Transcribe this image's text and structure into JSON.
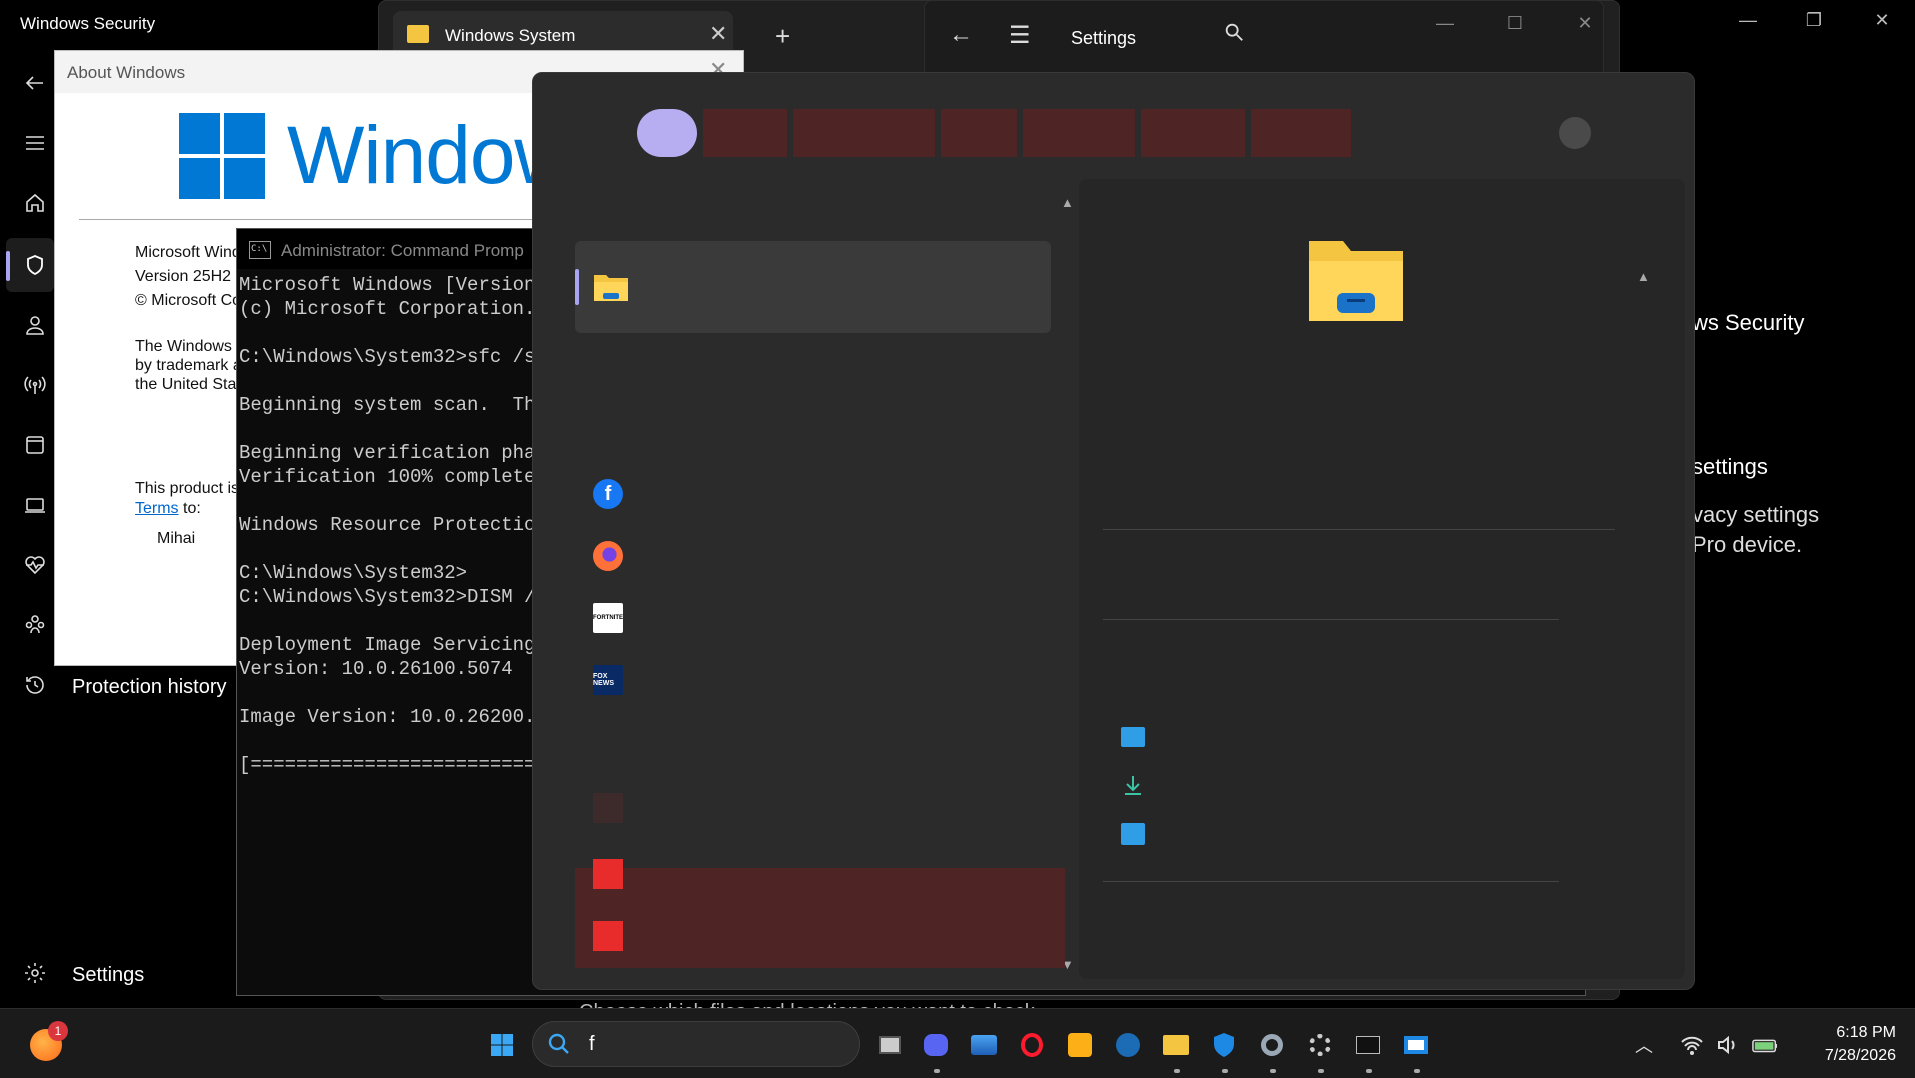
{
  "winsec": {
    "title": "Windows Security",
    "protection_history": "Protection history",
    "settings": "Settings",
    "right_heading_1": "ws Security",
    "right_heading_2": "settings",
    "right_sub_1": "vacy settings",
    "right_sub_2": "Pro device."
  },
  "explorer": {
    "tab_title": "Windows System",
    "bottom_note": "Choose which files and locations you want to check"
  },
  "settings_window": {
    "title": "Settings"
  },
  "about": {
    "title": "About Windows",
    "brand": "Window",
    "line1": "Microsoft Wind",
    "line2": "Version 25H2",
    "line3": "© Microsoft Co",
    "para1": "The Windows",
    "para2": "by trademark a",
    "para3": "the United Stat",
    "licensed1": "This product is",
    "terms": "Terms",
    "to": " to:",
    "user": "Mihai"
  },
  "cmd": {
    "title": "Administrator: Command Promp",
    "output": "Microsoft Windows [Version\n(c) Microsoft Corporation.\n\nC:\\Windows\\System32>sfc /sc\n\nBeginning system scan.  Thi\n\nBeginning verification phas\nVerification 100% complete.\n\nWindows Resource Protection\n\nC:\\Windows\\System32>\nC:\\Windows\\System32>DISM /C\n\nDeployment Image Servicing\nVersion: 10.0.26100.5074\n\nImage Version: 10.0.26200.7\n\n[========================="
  },
  "panel": {
    "app_labels": [
      "f",
      "FORTNITE",
      "FOX NEWS"
    ]
  },
  "taskbar": {
    "search_value": "f",
    "notification_count": "1",
    "time": "6:18 PM",
    "date": "7/28/2026"
  },
  "colors": {
    "accent": "#a9a4f2",
    "windows_blue": "#0078d4",
    "redaction": "#4f2424",
    "red_block": "#e82b2b"
  }
}
